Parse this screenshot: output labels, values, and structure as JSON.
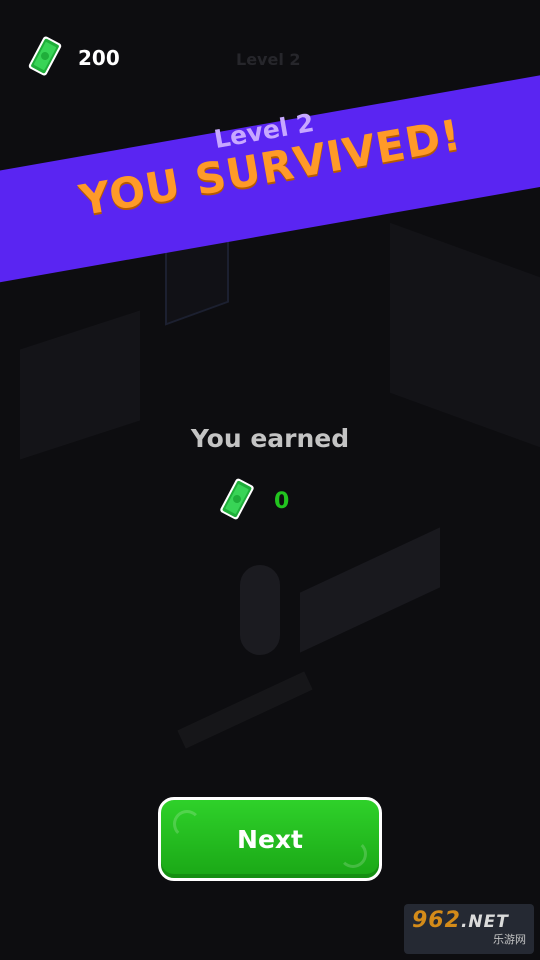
{
  "hud": {
    "money": "200",
    "faded_level": "Level 2"
  },
  "banner": {
    "level": "Level 2",
    "title": "YOU SURVIVED!"
  },
  "reward": {
    "title": "You earned",
    "amount": "0"
  },
  "buttons": {
    "next": "Next"
  },
  "watermark": {
    "main": "962",
    "suffix": ".NET",
    "sub": "乐游网"
  },
  "colors": {
    "banner": "#5a25f2",
    "title": "#ff9a28",
    "money_green": "#22c41f",
    "button_green": "#2fd12a"
  },
  "icons": {
    "currency": "cash-icon"
  }
}
